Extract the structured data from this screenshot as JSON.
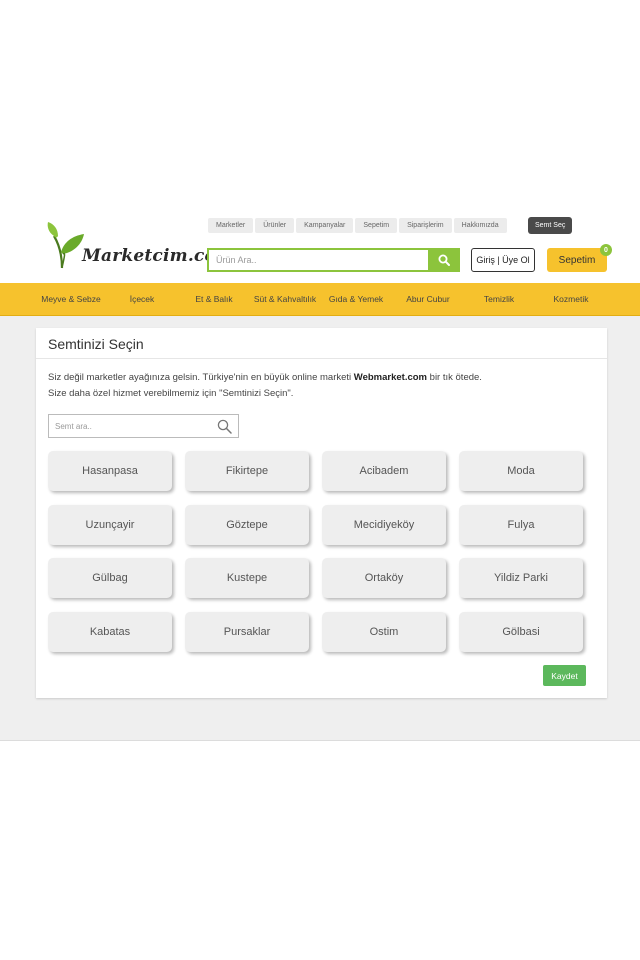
{
  "logo": {
    "wordmark": "Marketcim.com"
  },
  "topnav": [
    "Marketler",
    "Ürünler",
    "Kampanyalar",
    "Sepetim",
    "Siparişlerim",
    "Hakkımızda"
  ],
  "semt_sec_label": "Semt Seç",
  "search": {
    "placeholder": "Ürün Ara.."
  },
  "login_label": "Giriş | Üye Ol",
  "cart": {
    "label": "Sepetim",
    "count": "0"
  },
  "categories": [
    "Meyve & Sebze",
    "İçecek",
    "Et & Balık",
    "Süt & Kahvaltılık",
    "Gıda & Yemek",
    "Abur Cubur",
    "Temizlik",
    "Kozmetik"
  ],
  "panel": {
    "title": "Semtinizi Seçin",
    "desc_line1_prefix": "Siz değil marketler ayağınıza gelsin. Türkiye'nin en büyük online marketi ",
    "desc_line1_brand": "Webmarket.com",
    "desc_line1_suffix": " bir tık ötede.",
    "desc_line2": "Size daha özel hizmet verebilmemiz için \"Semtinizi Seçin\".",
    "search_placeholder": "Semt ara..",
    "save_label": "Kaydet"
  },
  "districts": [
    "Hasanpasa",
    "Fikirtepe",
    "Acibadem",
    "Moda",
    "Uzunçayir",
    "Göztepe",
    "Mecidiyeköy",
    "Fulya",
    "Gülbag",
    "Kustepe",
    "Ortaköy",
    "Yildiz Parki",
    "Kabatas",
    "Pursaklar",
    "Ostim",
    "Gölbasi"
  ],
  "colors": {
    "accent_green": "#8cc43c",
    "category_bar": "#f6c22d",
    "save_green": "#5cb85c"
  }
}
